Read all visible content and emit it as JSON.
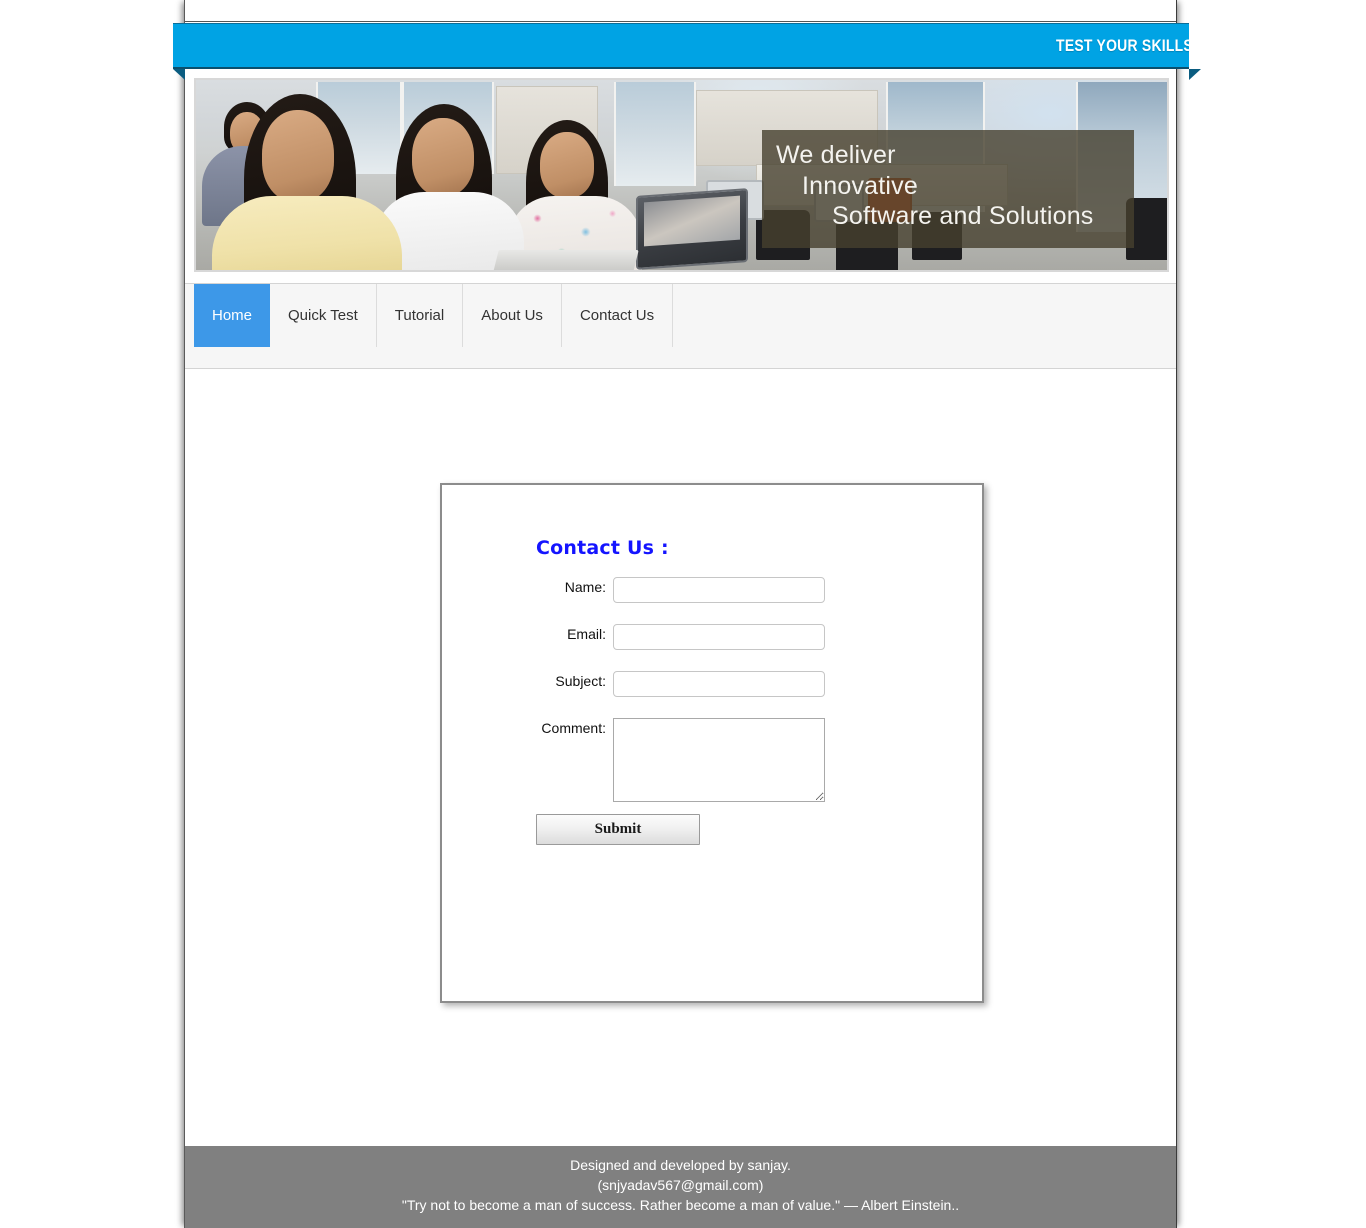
{
  "ribbon": {
    "text": "TEST YOUR SKILLS"
  },
  "hero": {
    "caption_line1": "We deliver",
    "caption_line2": "Innovative",
    "caption_line3": "Software and Solutions",
    "image_alt": "office-team-photo"
  },
  "nav": {
    "items": [
      {
        "label": "Home",
        "active": true
      },
      {
        "label": "Quick Test",
        "active": false
      },
      {
        "label": "Tutorial",
        "active": false
      },
      {
        "label": "About Us",
        "active": false
      },
      {
        "label": "Contact Us",
        "active": false
      }
    ]
  },
  "contact": {
    "heading": "Contact Us :",
    "fields": [
      {
        "label": "Name:",
        "value": "",
        "placeholder": ""
      },
      {
        "label": "Email:",
        "value": "",
        "placeholder": ""
      },
      {
        "label": "Subject:",
        "value": "",
        "placeholder": ""
      }
    ],
    "comment": {
      "label": "Comment:",
      "value": "",
      "placeholder": ""
    },
    "submit_label": "Submit"
  },
  "footer": {
    "line1": "Designed and developed by sanjay.",
    "line2": "(snjyadav567@gmail.com)",
    "line3": "\"Try not to become a man of success. Rather become a man of value.\" — Albert Einstein.."
  },
  "colors": {
    "ribbon_blue": "#00a3e4",
    "nav_active_blue": "#3d98e8",
    "heading_blue": "#1414ff",
    "footer_gray": "#808080",
    "caption_overlay": "rgba(70,64,46,0.80)"
  }
}
